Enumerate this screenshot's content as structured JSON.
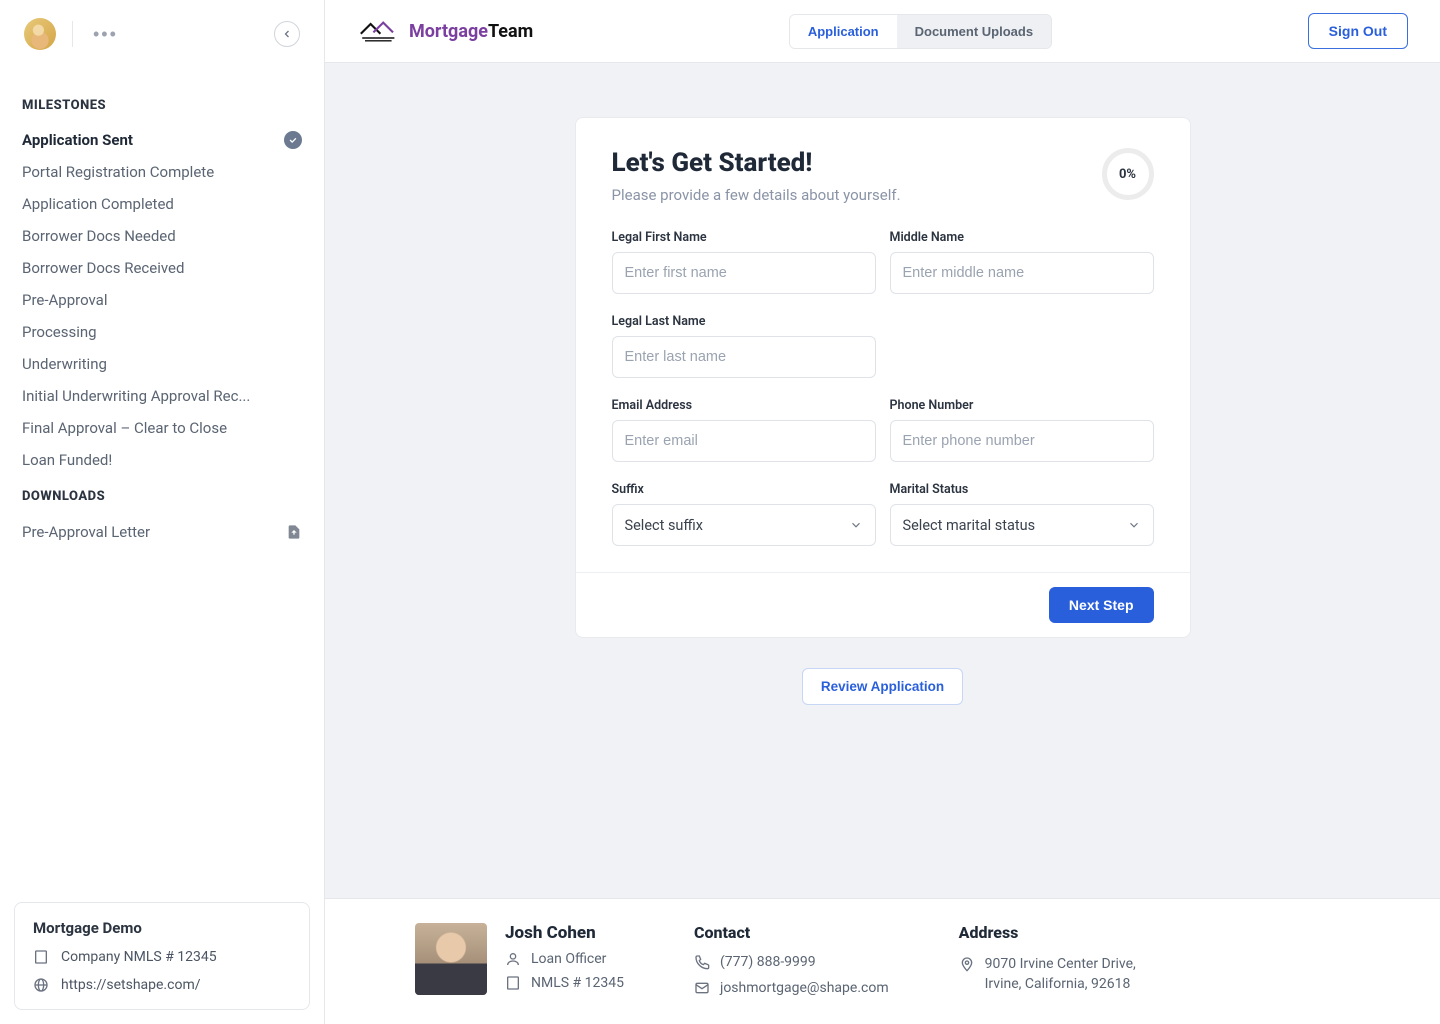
{
  "sidebar": {
    "milestones_title": "MILESTONES",
    "milestones": [
      {
        "label": "Application Sent",
        "active": true,
        "done": true
      },
      {
        "label": "Portal Registration Complete"
      },
      {
        "label": "Application Completed"
      },
      {
        "label": "Borrower Docs Needed"
      },
      {
        "label": "Borrower Docs Received"
      },
      {
        "label": "Pre-Approval"
      },
      {
        "label": "Processing"
      },
      {
        "label": "Underwriting"
      },
      {
        "label": "Initial Underwriting Approval Rec..."
      },
      {
        "label": "Final Approval – Clear to Close"
      },
      {
        "label": "Loan Funded!"
      }
    ],
    "downloads_title": "DOWNLOADS",
    "downloads": [
      {
        "label": "Pre-Approval Letter"
      }
    ],
    "company": {
      "name": "Mortgage Demo",
      "nmls": "Company NMLS # 12345",
      "website": "https://setshape.com/"
    }
  },
  "header": {
    "brand_primary": "Mortgage",
    "brand_secondary": "Team",
    "tabs": {
      "application": "Application",
      "uploads": "Document Uploads"
    },
    "signout": "Sign Out"
  },
  "form": {
    "title": "Let's Get Started!",
    "subtitle": "Please provide a few details about yourself.",
    "progress": "0%",
    "first_name_label": "Legal First Name",
    "first_name_ph": "Enter first name",
    "middle_name_label": "Middle Name",
    "middle_name_ph": "Enter middle name",
    "last_name_label": "Legal Last Name",
    "last_name_ph": "Enter last name",
    "email_label": "Email Address",
    "email_ph": "Enter email",
    "phone_label": "Phone Number",
    "phone_ph": "Enter phone number",
    "suffix_label": "Suffix",
    "suffix_sel": "Select suffix",
    "marital_label": "Marital Status",
    "marital_sel": "Select marital status",
    "next": "Next Step",
    "review": "Review Application"
  },
  "footer": {
    "lo_name": "Josh Cohen",
    "lo_title": "Loan Officer",
    "lo_nmls": "NMLS # 12345",
    "contact_title": "Contact",
    "phone": "(777) 888-9999",
    "email": "joshmortgage@shape.com",
    "address_title": "Address",
    "address": "9070 Irvine Center Drive, Irvine, California, 92618"
  }
}
